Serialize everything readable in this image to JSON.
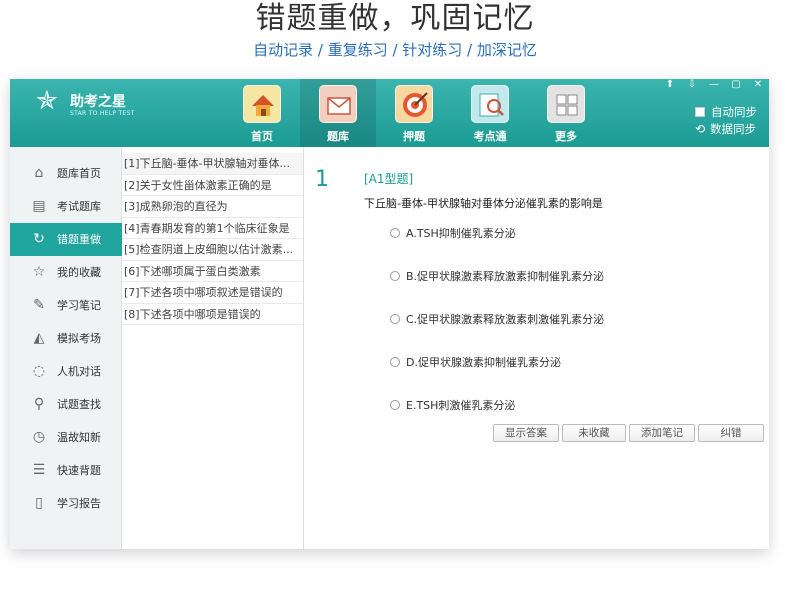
{
  "promo": {
    "title": "错题重做，巩固记忆",
    "subtitle": "自动记录 / 重复练习 / 针对练习 / 加深记忆"
  },
  "app": {
    "logo_name": "助考之星",
    "logo_tag": "STAR TO HELP TEST",
    "window_controls": [
      "⬆",
      "⇩",
      "—",
      "▢",
      "✕"
    ]
  },
  "nav": [
    {
      "label": "首页",
      "icon": "home-icon",
      "color": "#f6e6a3"
    },
    {
      "label": "题库",
      "icon": "envelope-icon",
      "color": "#f3cfc0"
    },
    {
      "label": "押题",
      "icon": "target-icon",
      "color": "#f7d8a0"
    },
    {
      "label": "考点通",
      "icon": "magnifier-icon",
      "color": "#bfe9ec"
    },
    {
      "label": "更多",
      "icon": "grid-icon",
      "color": "#e3e3e3"
    }
  ],
  "sync": {
    "auto_sync": "自动同步",
    "data_sync": "数据同步"
  },
  "sidebar": [
    {
      "label": "题库首页",
      "icon": "home-outline-icon"
    },
    {
      "label": "考试题库",
      "icon": "document-icon"
    },
    {
      "label": "错题重做",
      "icon": "refresh-icon",
      "active": true
    },
    {
      "label": "我的收藏",
      "icon": "star-icon"
    },
    {
      "label": "学习笔记",
      "icon": "pencil-icon"
    },
    {
      "label": "模拟考场",
      "icon": "graduation-cap-icon"
    },
    {
      "label": "人机对话",
      "icon": "chat-icon"
    },
    {
      "label": "试题查找",
      "icon": "search-icon"
    },
    {
      "label": "温故知新",
      "icon": "clock-icon"
    },
    {
      "label": "快速背题",
      "icon": "list-icon"
    },
    {
      "label": "学习报告",
      "icon": "book-icon"
    }
  ],
  "questions": [
    "[1]下丘脑-垂体-甲状腺轴对垂体...",
    "[2]关于女性甾体激素正确的是",
    "[3]成熟卵泡的直径为",
    "[4]青春期发育的第1个临床征象是",
    "[5]检查阴道上皮细胞以估计激素...",
    "[6]下述哪项属于蛋白类激素",
    "[7]下述各项中哪项叙述是错误的",
    "[8]下述各项中哪项是错误的"
  ],
  "current": {
    "number": "1",
    "type": "[A1型题]",
    "stem": "下丘脑-垂体-甲状腺轴对垂体分泌催乳素的影响是",
    "options": [
      "A.TSH抑制催乳素分泌",
      "B.促甲状腺激素释放激素抑制催乳素分泌",
      "C.促甲状腺激素释放激素刺激催乳素分泌",
      "D.促甲状腺激素抑制催乳素分泌",
      "E.TSH刺激催乳素分泌"
    ]
  },
  "actions": {
    "show_answer": "显示答案",
    "unfavorite": "未收藏",
    "add_note": "添加笔记",
    "report_error": "纠错"
  },
  "colors": {
    "accent": "#1fa59e",
    "link": "#2a6fb8"
  }
}
